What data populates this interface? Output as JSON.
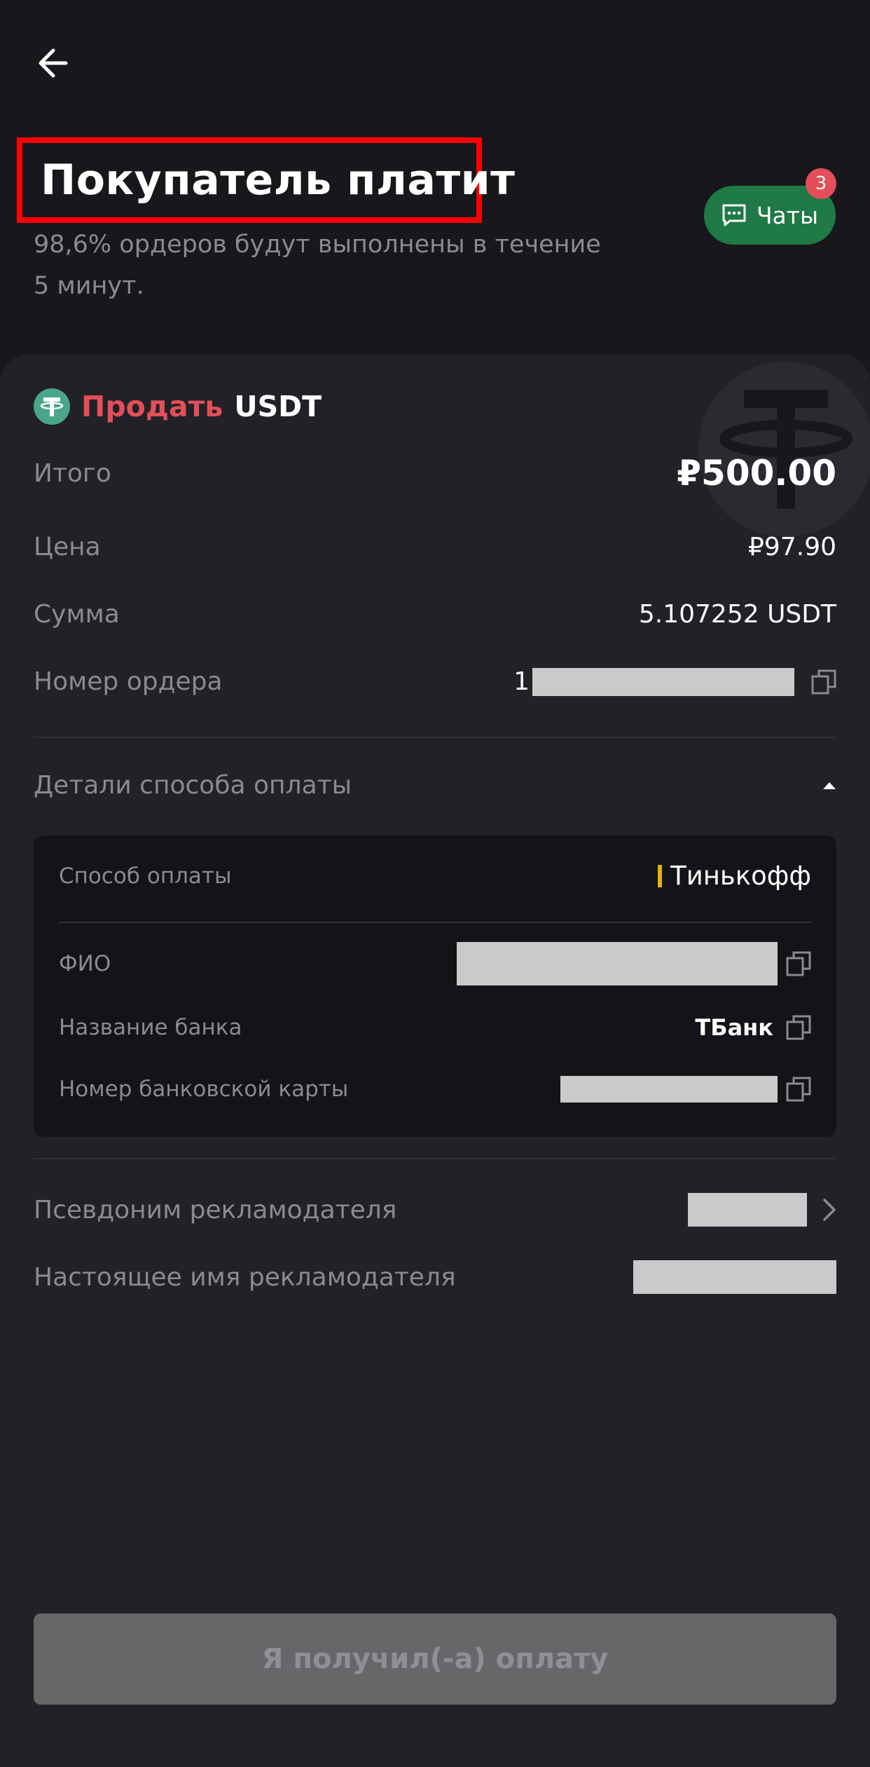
{
  "header": {
    "title": "Покупатель платит",
    "subtitle": "98,6% ордеров будут выполнены в течение 5 минут.",
    "chat": {
      "label": "Чаты",
      "badge": "3"
    }
  },
  "order": {
    "action": "Продать",
    "asset": "USDT",
    "rows": {
      "total": {
        "label": "Итого",
        "value": "₽500.00"
      },
      "price": {
        "label": "Цена",
        "value": "₽97.90"
      },
      "amount": {
        "label": "Сумма",
        "value": "5.107252 USDT"
      },
      "order_number": {
        "label": "Номер ордера",
        "value_prefix": "1"
      }
    }
  },
  "payment": {
    "section_label": "Детали способа оплаты",
    "method": {
      "label": "Способ оплаты",
      "value": "Тинькофф"
    },
    "fio": {
      "label": "ФИО"
    },
    "bank": {
      "label": "Название банка",
      "value": "ТБанк"
    },
    "card": {
      "label": "Номер банковской карты"
    }
  },
  "advertiser": {
    "nickname_label": "Псевдоним рекламодателя",
    "real_name_label": "Настоящее имя рекламодателя"
  },
  "confirm_button": "Я получил(-а) оплату",
  "colors": {
    "accent_green": "#1f7a45",
    "sell_red": "#e34f58",
    "bank_yellow": "#e7b10b"
  }
}
